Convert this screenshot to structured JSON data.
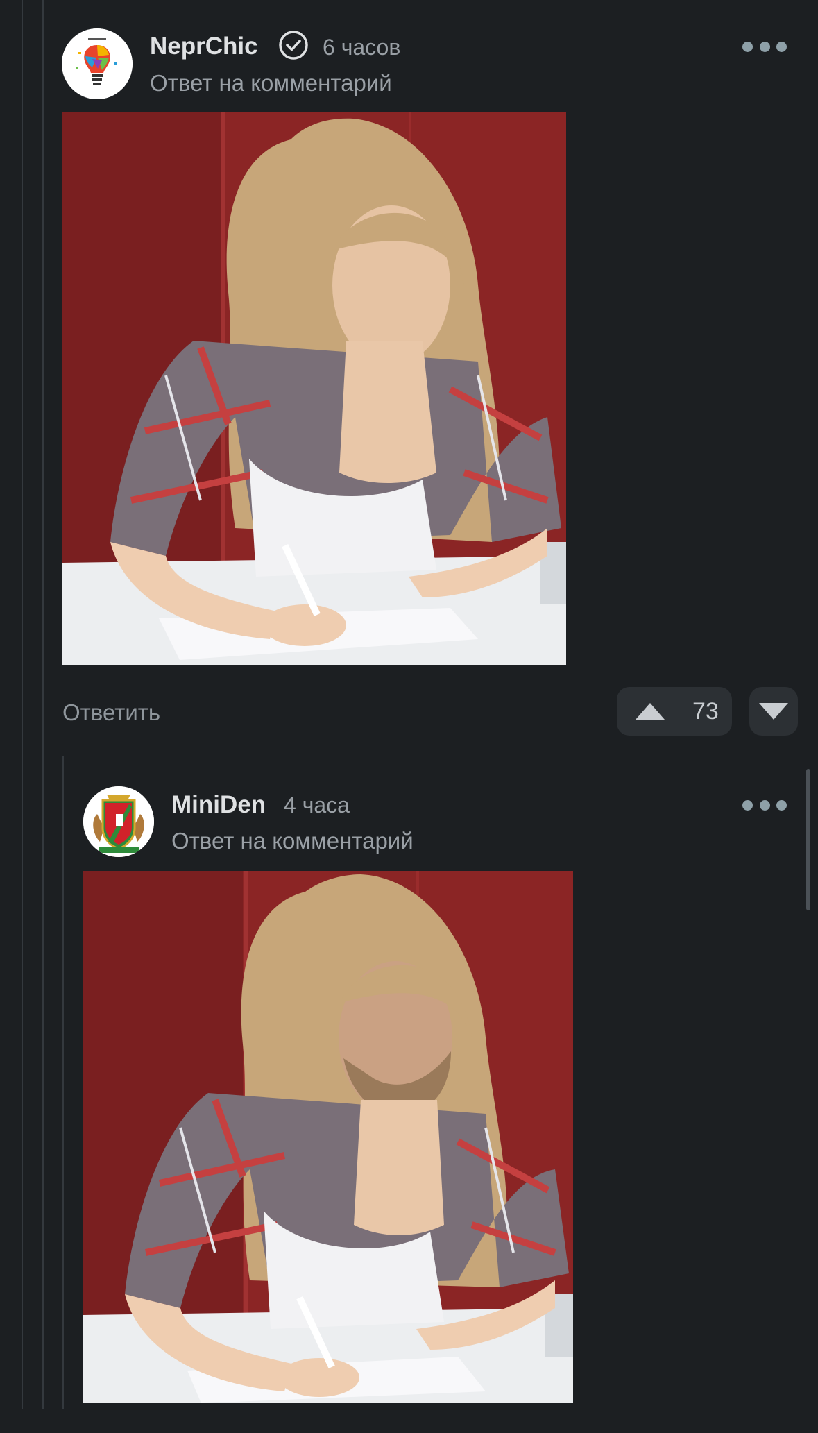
{
  "comments": [
    {
      "username": "NeprChic",
      "verified": true,
      "time": "6 часов",
      "subtitle": "Ответ на комментарий",
      "avatar_icon": "lightbulb-avatar-icon",
      "photo": "woman-signing-papers-photo",
      "reply_label": "Ответить",
      "score": "73"
    },
    {
      "username": "MiniDen",
      "verified": false,
      "time": "4 часа",
      "subtitle": "Ответ на комментарий",
      "avatar_icon": "coat-of-arms-avatar-icon",
      "photo": "edited-face-signing-papers-photo"
    }
  ],
  "colors": {
    "background": "#1c1f22",
    "vote_button": "#2c3034",
    "dots": "#8ea0a8",
    "muted_text": "#9aa0a6"
  }
}
